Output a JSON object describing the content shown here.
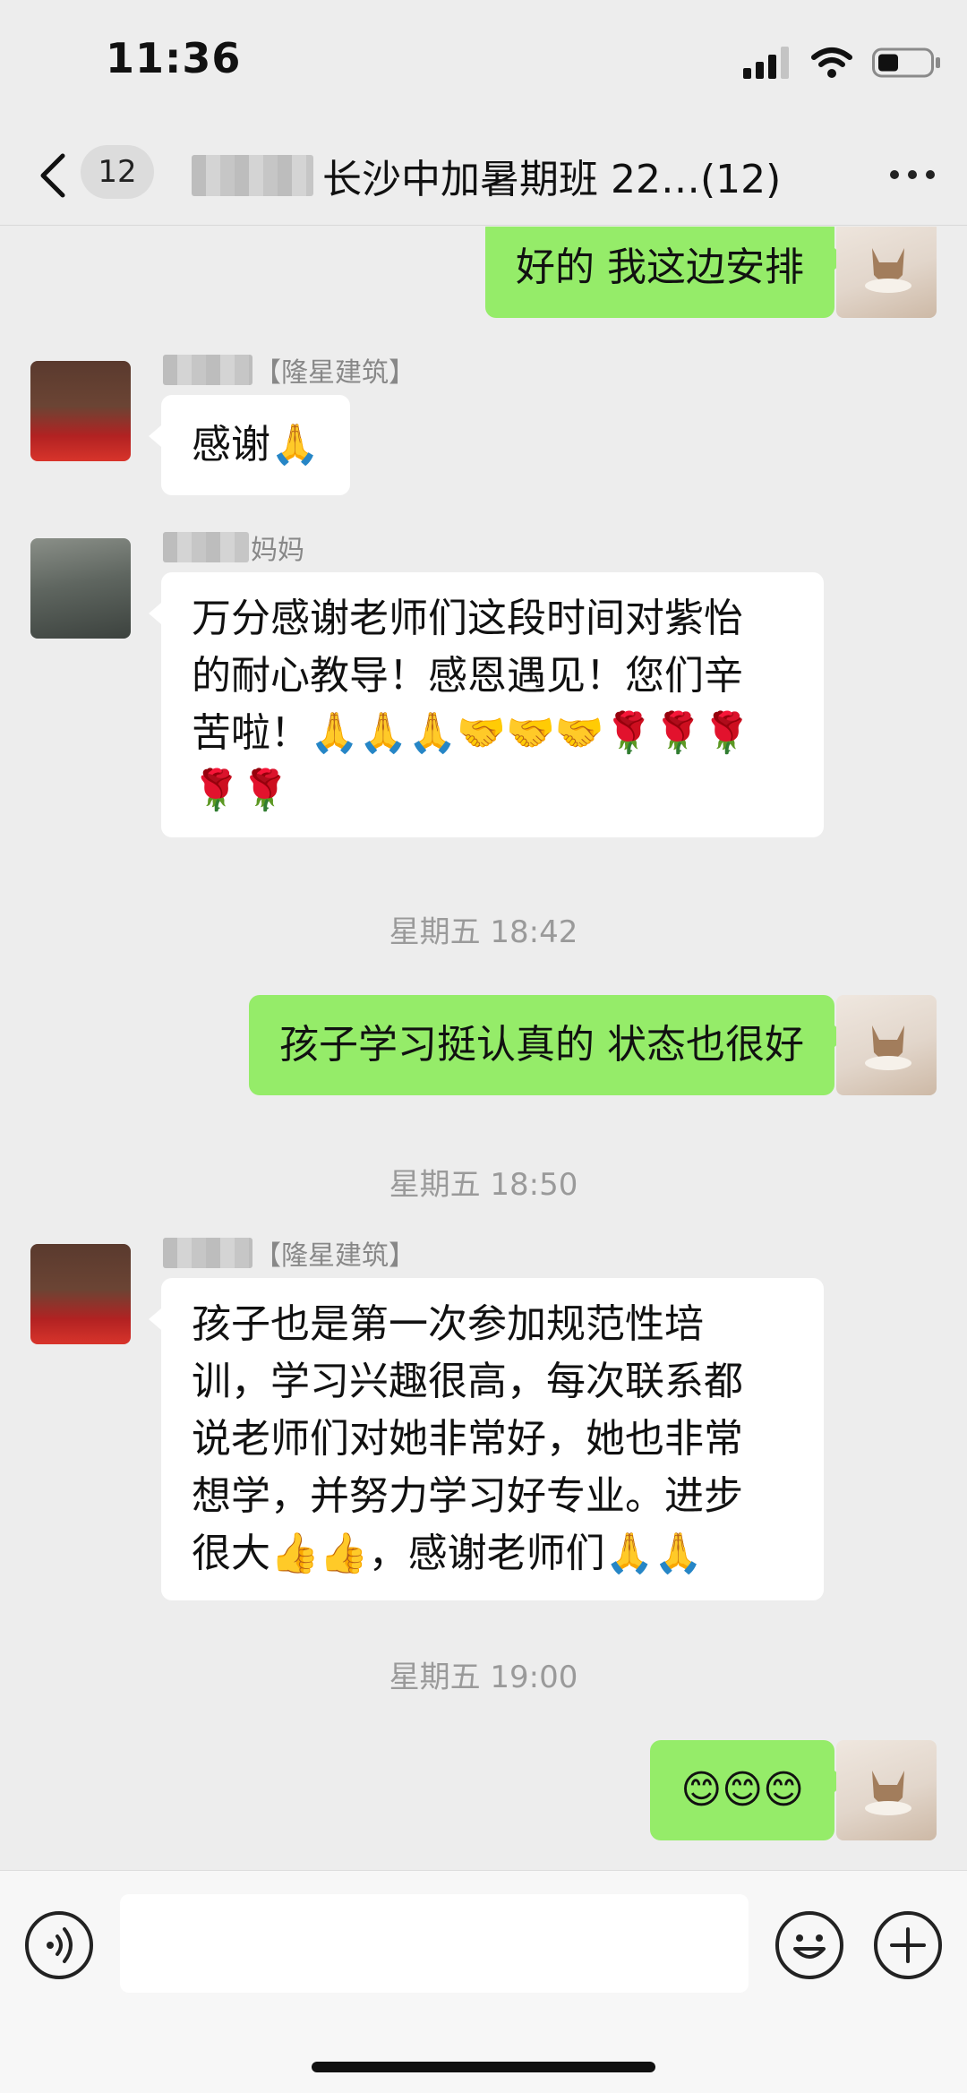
{
  "status_bar": {
    "time": "11:36"
  },
  "nav": {
    "unread_count": "12",
    "title": "长沙中加暑期班 22…(12)"
  },
  "messages": [
    {
      "text": "好的 我这边安排"
    },
    {
      "sender_suffix": "【隆星建筑】",
      "text": "感谢🙏"
    },
    {
      "sender_suffix": "妈妈",
      "text": "万分感谢老师们这段时间对紫怡\n的耐心教导！感恩遇见！您们辛\n苦啦！🙏🙏🙏🤝🤝🤝🌹🌹🌹\n🌹🌹"
    },
    {
      "text": "孩子学习挺认真的 状态也很好"
    },
    {
      "sender_suffix": "【隆星建筑】",
      "text": "孩子也是第一次参加规范性培\n训，学习兴趣很高，每次联系都\n说老师们对她非常好，她也非常\n想学，并努力学习好专业。进步\n很大👍👍，感谢老师们🙏🙏"
    },
    {
      "text": "😊😊😊"
    }
  ],
  "timestamps": [
    "星期五 18:42",
    "星期五 18:50",
    "星期五 19:00"
  ],
  "input": {
    "placeholder": ""
  },
  "colors": {
    "outgoing_bubble": "#95ec69",
    "incoming_bubble": "#ffffff",
    "background": "#ededed"
  }
}
